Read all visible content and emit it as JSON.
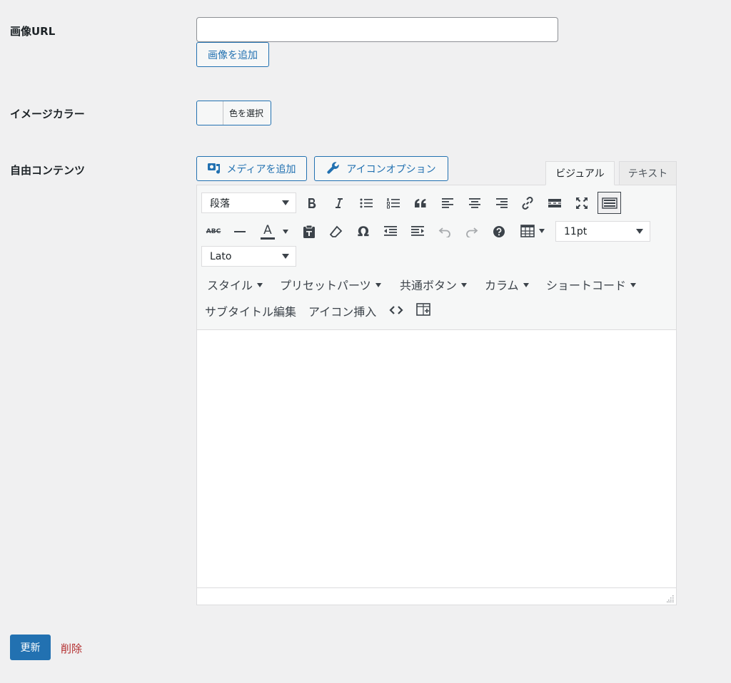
{
  "fields": {
    "image_url": {
      "label": "画像URL",
      "value": "",
      "placeholder": "",
      "add_button": "画像を追加"
    },
    "image_color": {
      "label": "イメージカラー",
      "button": "色を選択"
    },
    "free_content": {
      "label": "自由コンテンツ"
    }
  },
  "editor": {
    "media_button": "メディアを追加",
    "icon_option_button": "アイコンオプション",
    "tabs": [
      "ビジュアル",
      "テキスト"
    ],
    "active_tab": "ビジュアル",
    "format_select": "段落",
    "fontsize_select": "11pt",
    "fontfamily_select": "Lato",
    "menus": [
      "スタイル",
      "プリセットパーツ",
      "共通ボタン",
      "カラム",
      "ショートコード"
    ],
    "text_buttons": [
      "サブタイトル編集",
      "アイコン挿入"
    ],
    "abc_label": "ABC",
    "text_color_label": "A",
    "omega_label": "Ω",
    "content": ""
  },
  "actions": {
    "update": "更新",
    "delete": "削除"
  },
  "colors": {
    "accent": "#2271b1",
    "danger": "#b32d2e",
    "background": "#f0f0f1"
  }
}
